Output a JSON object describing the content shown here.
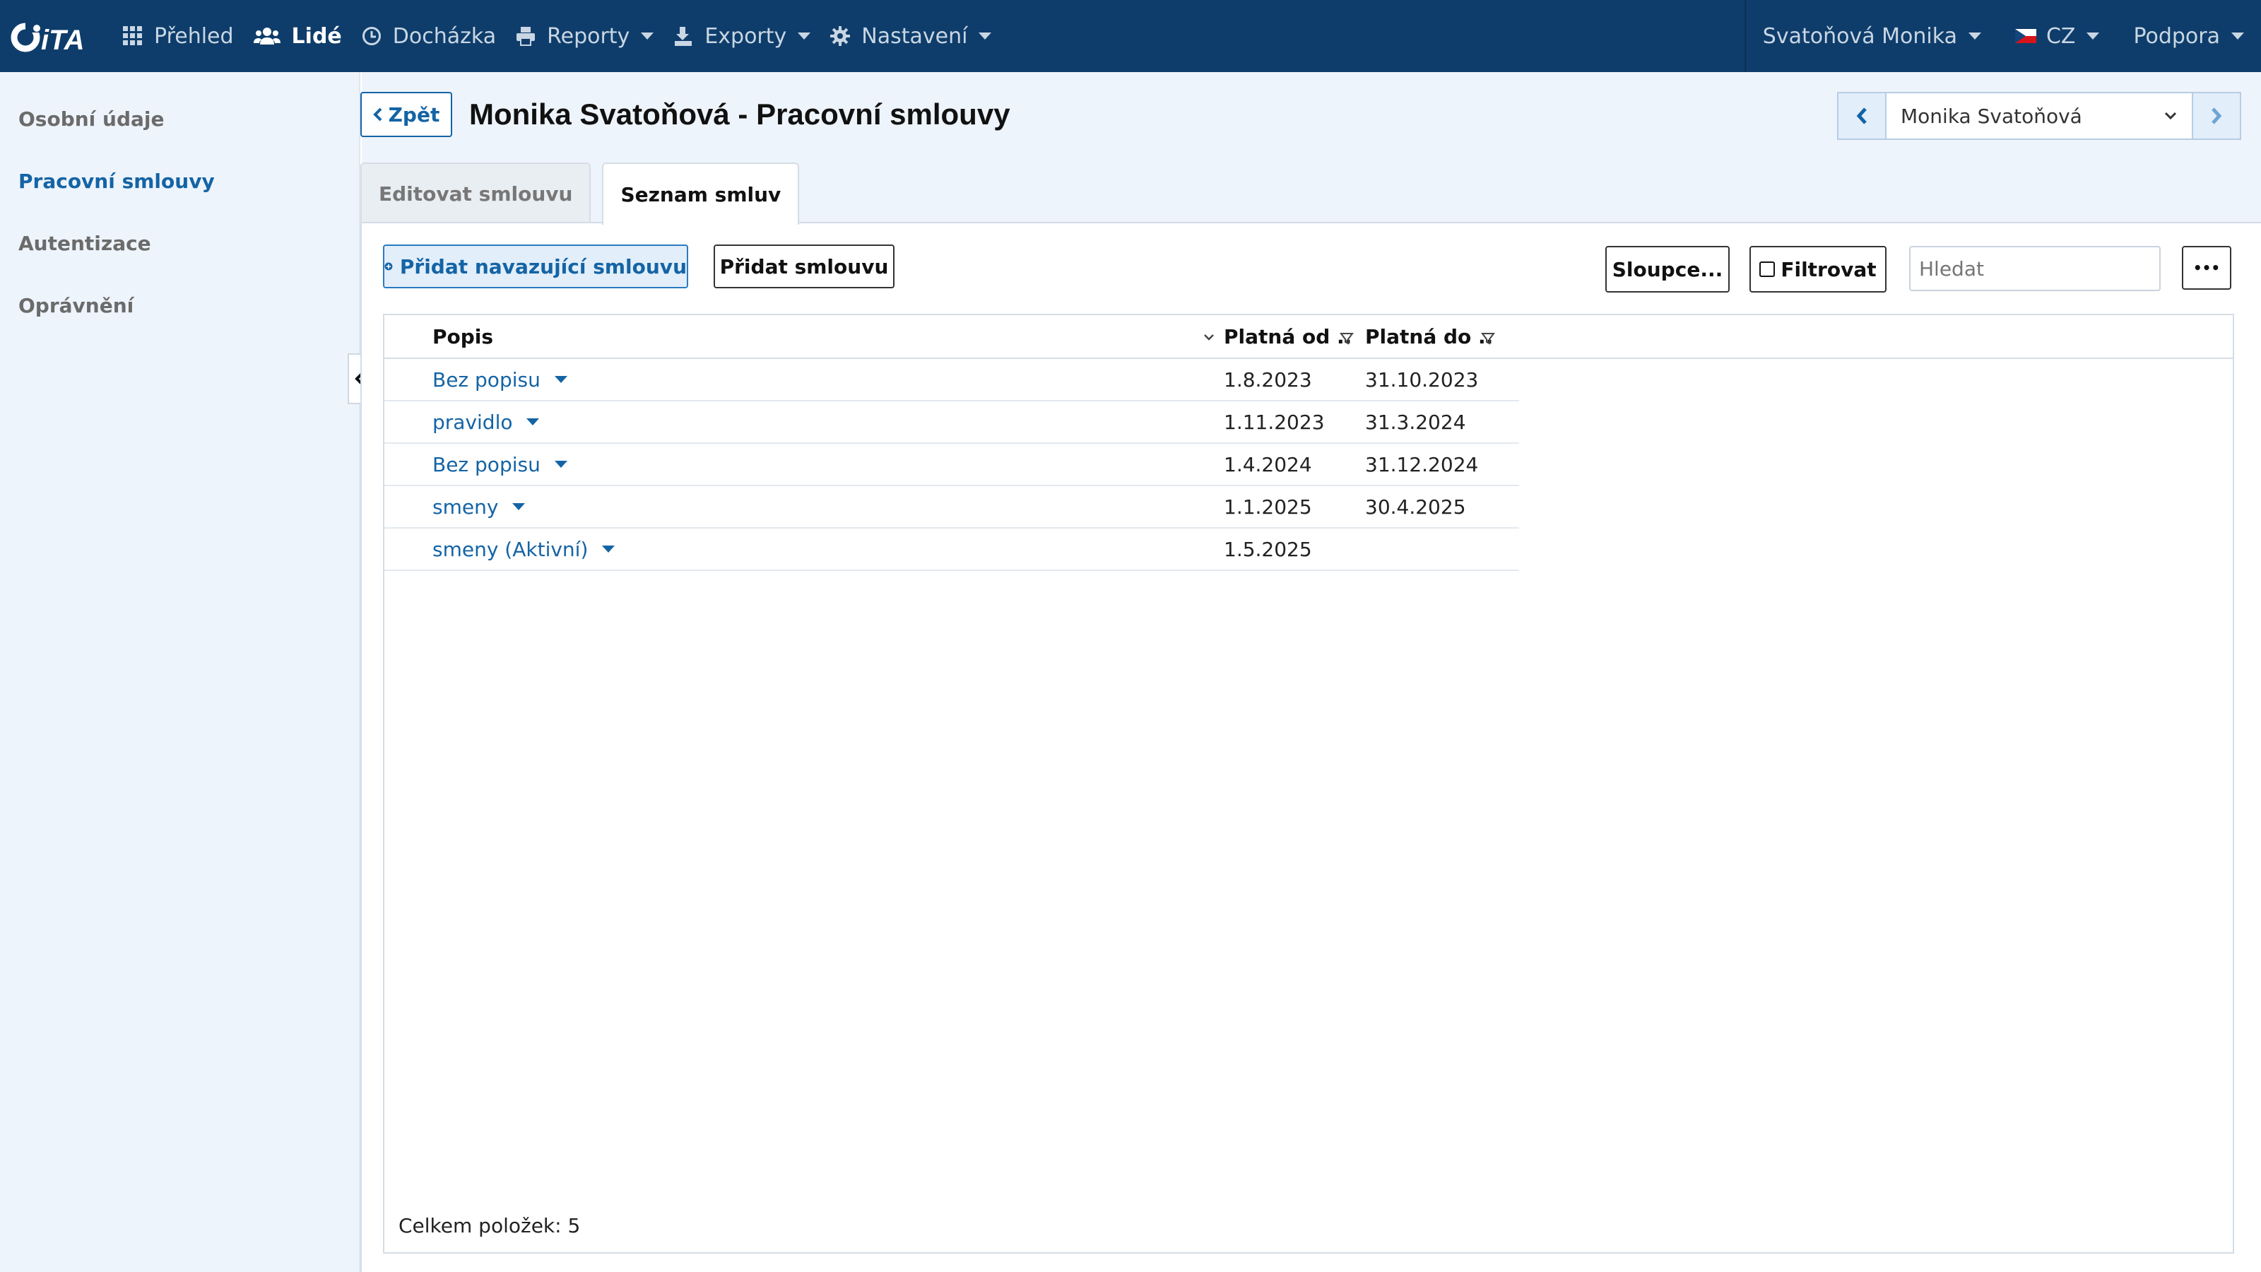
{
  "app": {
    "logo_text": "CITA"
  },
  "nav": {
    "items": [
      {
        "label": "Přehled",
        "icon": "grid-icon"
      },
      {
        "label": "Lidé",
        "icon": "users-icon",
        "active": true
      },
      {
        "label": "Docházka",
        "icon": "clock-icon"
      },
      {
        "label": "Reporty",
        "icon": "print-icon",
        "dropdown": true
      },
      {
        "label": "Exporty",
        "icon": "export-icon",
        "dropdown": true
      },
      {
        "label": "Nastavení",
        "icon": "gear-icon",
        "dropdown": true
      }
    ],
    "user": "Svatoňová Monika",
    "language": "CZ",
    "support": "Podpora"
  },
  "sidebar": {
    "items": [
      {
        "label": "Osobní údaje"
      },
      {
        "label": "Pracovní smlouvy",
        "active": true
      },
      {
        "label": "Autentizace"
      },
      {
        "label": "Oprávnění"
      }
    ]
  },
  "header": {
    "back_label": "Zpět",
    "title": "Monika Svatoňová - Pracovní smlouvy",
    "person_select": "Monika Svatoňová"
  },
  "tabs": [
    {
      "label": "Editovat smlouvu"
    },
    {
      "label": "Seznam smluv",
      "active": true
    }
  ],
  "toolbar": {
    "add_follow_label": "Přidat navazující smlouvu",
    "add_label": "Přidat smlouvu",
    "columns_label": "Sloupce...",
    "filter_label": "Filtrovat",
    "search_placeholder": "Hledat",
    "more_label": "•••"
  },
  "table": {
    "columns": [
      "Popis",
      "Platná od ..",
      "Platná do .."
    ],
    "rows": [
      {
        "popis": "Bez popisu",
        "od": "1.8.2023",
        "do": "31.10.2023"
      },
      {
        "popis": "pravidlo",
        "od": "1.11.2023",
        "do": "31.3.2024"
      },
      {
        "popis": "Bez popisu",
        "od": "1.4.2024",
        "do": "31.12.2024"
      },
      {
        "popis": "smeny",
        "od": "1.1.2025",
        "do": "30.4.2025"
      },
      {
        "popis": "smeny (Aktivní)",
        "od": "1.5.2025",
        "do": ""
      }
    ],
    "total_label": "Celkem položek: 5"
  },
  "colors": {
    "topbar": "#0e3d6b",
    "accent": "#1464a5",
    "sidebar_bg": "#eef4fb"
  }
}
